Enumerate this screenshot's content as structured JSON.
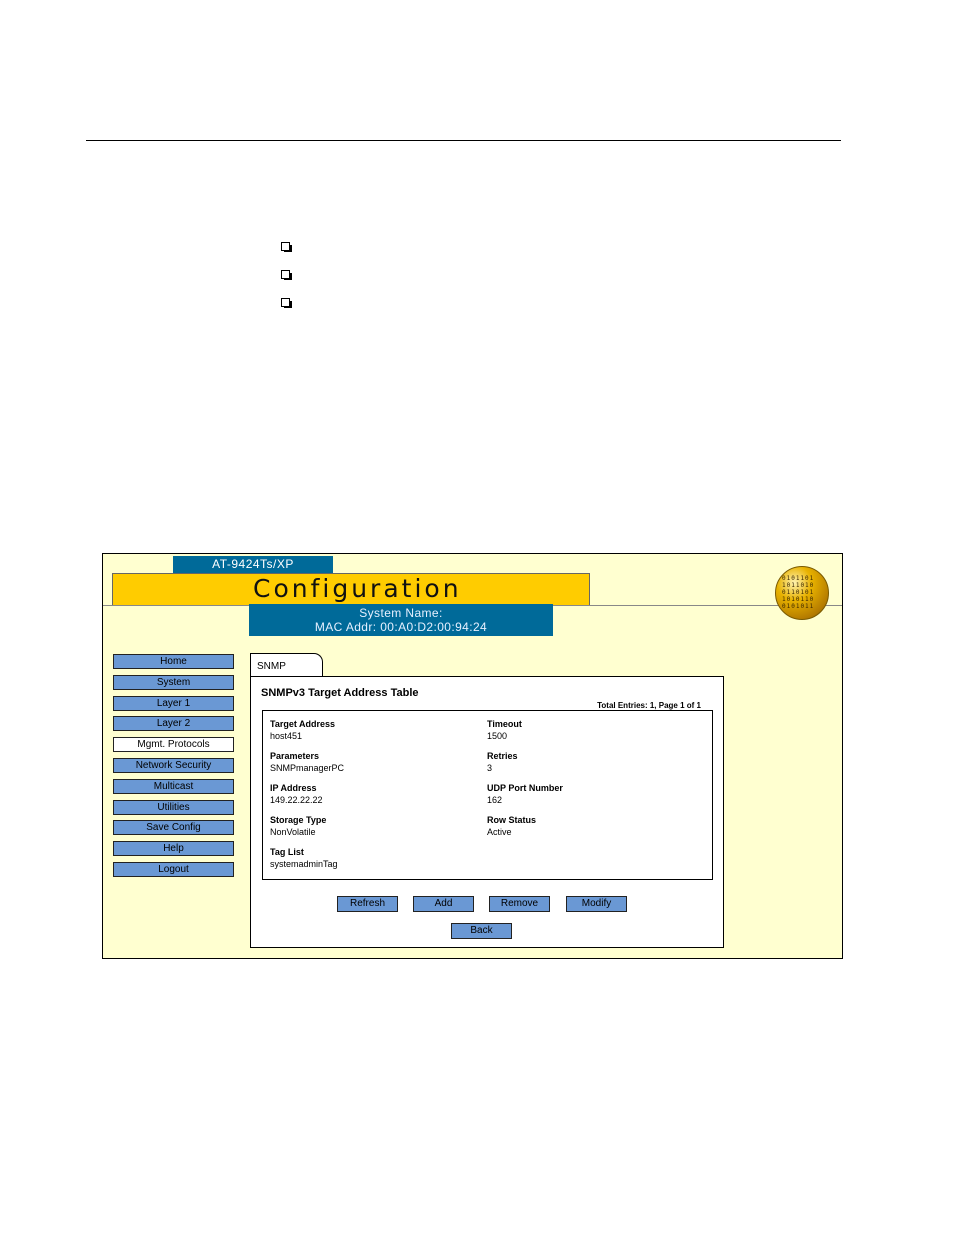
{
  "header": {
    "model": "AT-9424Ts/XP",
    "title": "Configuration",
    "system_name": "System Name:",
    "mac_addr": "MAC Addr: 00:A0:D2:00:94:24"
  },
  "nav": {
    "items": [
      {
        "label": "Home"
      },
      {
        "label": "System"
      },
      {
        "label": "Layer 1"
      },
      {
        "label": "Layer 2"
      },
      {
        "label": "Mgmt. Protocols",
        "active": true
      },
      {
        "label": "Network Security"
      },
      {
        "label": "Multicast"
      },
      {
        "label": "Utilities"
      },
      {
        "label": "Save Config"
      },
      {
        "label": "Help"
      },
      {
        "label": "Logout"
      }
    ]
  },
  "tab": {
    "label": "SNMP"
  },
  "table": {
    "title": "SNMPv3 Target Address Table",
    "total_entries": "Total Entries: 1, Page 1 of 1",
    "fields": {
      "target_address": {
        "label": "Target Address",
        "value": "host451"
      },
      "timeout": {
        "label": "Timeout",
        "value": "1500"
      },
      "parameters": {
        "label": "Parameters",
        "value": "SNMPmanagerPC"
      },
      "retries": {
        "label": "Retries",
        "value": "3"
      },
      "ip_address": {
        "label": "IP Address",
        "value": "149.22.22.22"
      },
      "udp_port": {
        "label": "UDP Port Number",
        "value": "162"
      },
      "storage_type": {
        "label": "Storage Type",
        "value": "NonVolatile"
      },
      "row_status": {
        "label": "Row Status",
        "value": "Active"
      },
      "tag_list": {
        "label": "Tag List",
        "value": "systemadminTag"
      }
    }
  },
  "actions": {
    "refresh": "Refresh",
    "add": "Add",
    "remove": "Remove",
    "modify": "Modify",
    "back": "Back"
  },
  "icons": {
    "bullets": [
      "checkbox-bullet-icon",
      "checkbox-bullet-icon",
      "checkbox-bullet-icon"
    ],
    "globe": "globe-logo-icon"
  },
  "colors": {
    "frame_bg": "#ffffd0",
    "title_band": "#ffcc00",
    "header_blue": "#006a99",
    "button_blue": "#6a98d4"
  }
}
